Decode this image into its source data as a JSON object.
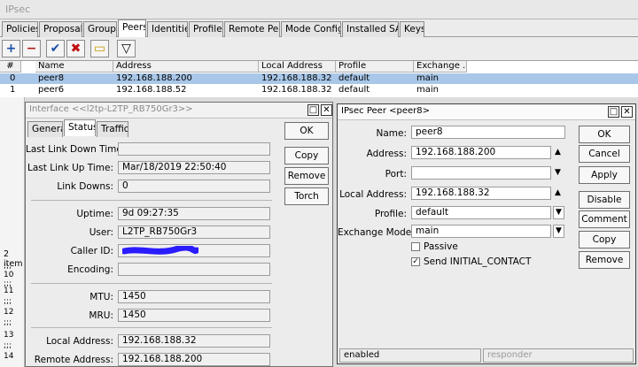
{
  "window": {
    "title": "IPsec"
  },
  "tabs": [
    "Policies",
    "Proposals",
    "Groups",
    "Peers",
    "Identities",
    "Profiles",
    "Remote Peers",
    "Mode Configs",
    "Installed SAs",
    "Keys"
  ],
  "active_tab": "Peers",
  "toolbar": {
    "add": "+",
    "remove": "−",
    "enable": "✔",
    "disable": "✖",
    "comment": "▭",
    "filter": "▽"
  },
  "table": {
    "headers": [
      "#",
      "Name",
      "Address",
      "Local Address",
      "Profile",
      "Exchange ..."
    ],
    "rows": [
      {
        "idx": "0",
        "name": "peer8",
        "address": "192.168.188.200",
        "local": "192.168.188.32",
        "profile": "default",
        "exchange": "main"
      },
      {
        "idx": "1",
        "name": "peer6",
        "address": "192.168.188.52",
        "local": "192.168.188.32",
        "profile": "default",
        "exchange": "main"
      }
    ],
    "item_count": "2 item"
  },
  "left_strip": [
    ";;;",
    "10",
    ";;;",
    "11",
    ";;;",
    "12",
    ";;;",
    "13",
    ";;;",
    "14"
  ],
  "iface": {
    "title": "Interface <<l2tp-L2TP_RB750Gr3>>",
    "tabs": [
      "General",
      "Status",
      "Traffic"
    ],
    "active_tab": "Status",
    "fields": {
      "last_down_label": "Last Link Down Time:",
      "last_down": "",
      "last_up_label": "Last Link Up Time:",
      "last_up": "Mar/18/2019 22:50:40",
      "link_downs_label": "Link Downs:",
      "link_downs": "0",
      "uptime_label": "Uptime:",
      "uptime": "9d 09:27:35",
      "user_label": "User:",
      "user": "L2TP_RB750Gr3",
      "caller_label": "Caller ID:",
      "caller": "",
      "encoding_label": "Encoding:",
      "encoding": "",
      "mtu_label": "MTU:",
      "mtu": "1450",
      "mru_label": "MRU:",
      "mru": "1450",
      "local_label": "Local Address:",
      "local": "192.168.188.32",
      "remote_label": "Remote Address:",
      "remote": "192.168.188.200"
    },
    "buttons": [
      "OK",
      "Copy",
      "Remove",
      "Torch"
    ]
  },
  "peer": {
    "title": "IPsec Peer <peer8>",
    "name_label": "Name:",
    "name": "peer8",
    "address_label": "Address:",
    "address": "192.168.188.200",
    "port_label": "Port:",
    "port": "",
    "local_label": "Local Address:",
    "local": "192.168.188.32",
    "profile_label": "Profile:",
    "profile": "default",
    "exchange_label": "Exchange Mode:",
    "exchange": "main",
    "passive_label": "Passive",
    "send_label": "Send INITIAL_CONTACT",
    "buttons": [
      "OK",
      "Cancel",
      "Apply",
      "Disable",
      "Comment",
      "Copy",
      "Remove"
    ],
    "status_left": "enabled",
    "status_right": "responder"
  }
}
